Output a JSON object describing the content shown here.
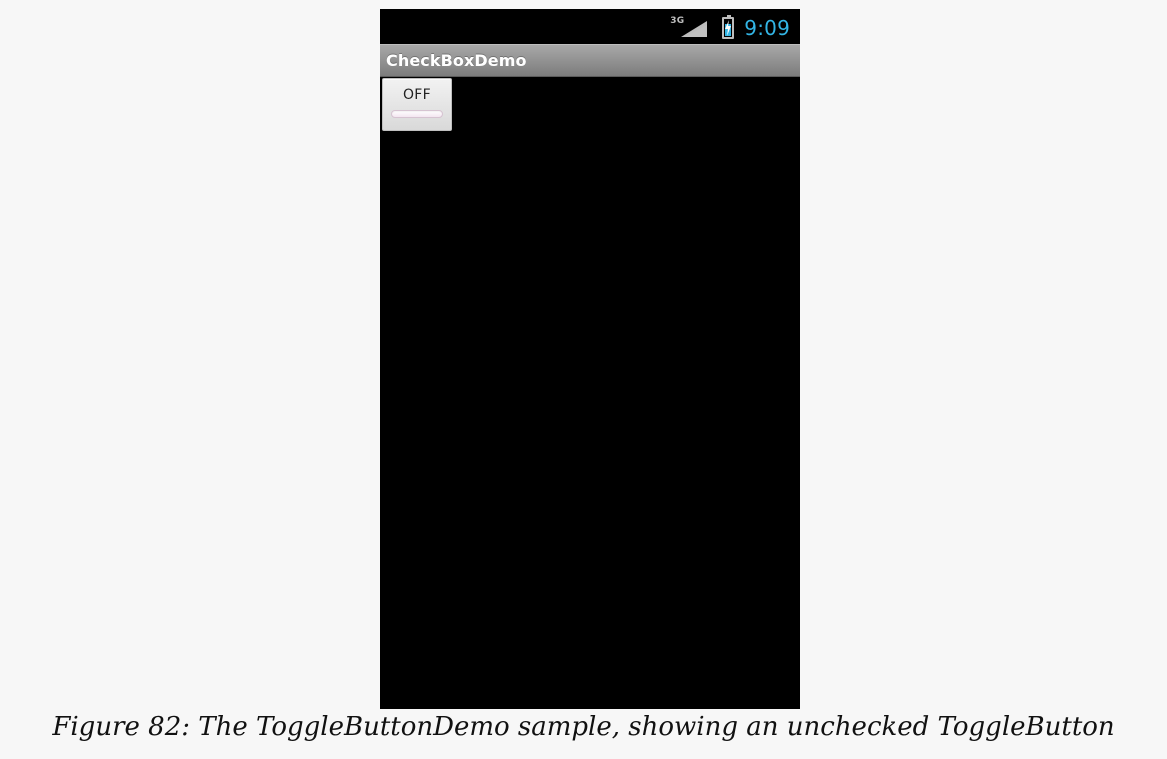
{
  "status_bar": {
    "network_type": "3G",
    "time": "9:09",
    "clock_color": "#33b5e5",
    "icons": [
      "signal-icon",
      "battery-charging-icon"
    ]
  },
  "app": {
    "title": "CheckBoxDemo"
  },
  "toggle_button": {
    "label": "OFF",
    "checked": false
  },
  "caption": "Figure 82: The ToggleButtonDemo sample, showing an unchecked ToggleButton"
}
